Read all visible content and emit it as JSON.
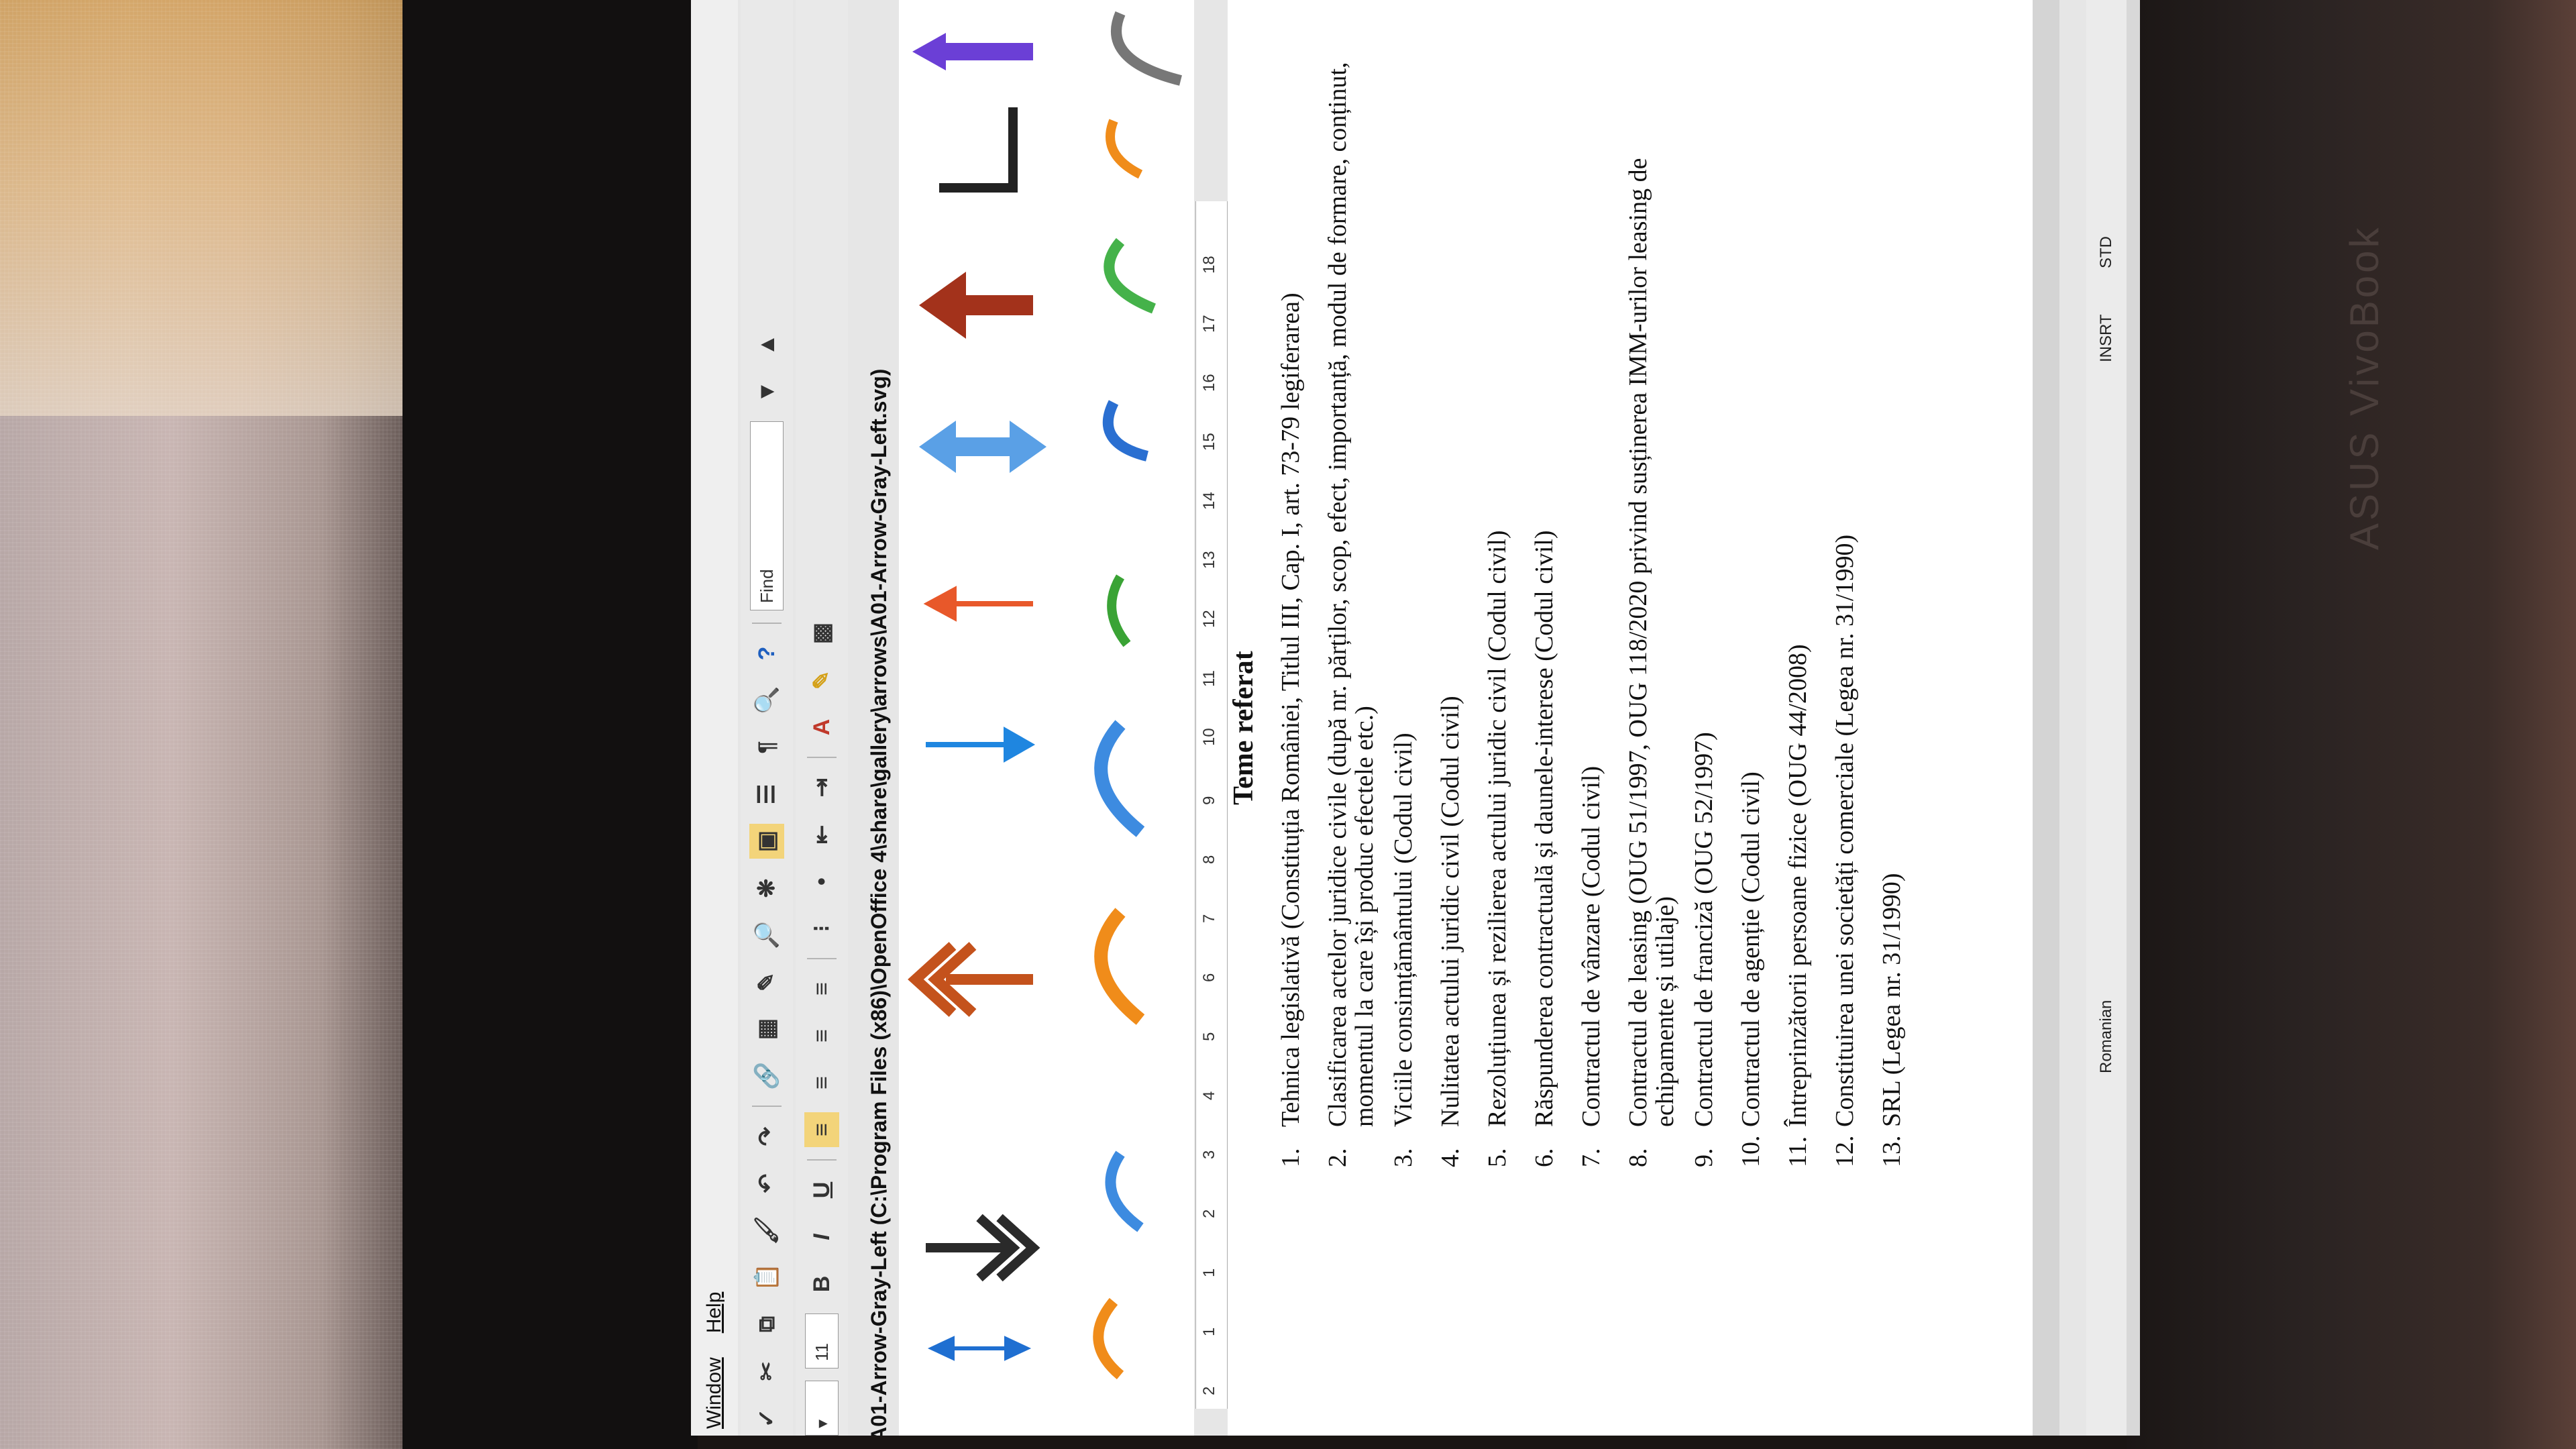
{
  "menu": {
    "items": [
      "Window",
      "Help"
    ]
  },
  "toolbar": {
    "font_size": "11",
    "find_placeholder": "Find",
    "bold": "B",
    "italic": "I",
    "underline": "U",
    "help_glyph": "?"
  },
  "document": {
    "path_title": "A01-Arrow-Gray-Left (C:\\Program Files (x86)\\OpenOffice 4\\share\\gallery\\arrows\\A01-Arrow-Gray-Left.svg)",
    "heading": "Teme referat",
    "topics": [
      "Tehnica legislativă (Constituția României, Titlul III, Cap. I, art. 73-79 legiferarea)",
      "Clasificarea actelor juridice civile (după nr. părților, scop, efect, importanță, modul de formare, conținut, momentul la care își produc efectele etc.)",
      "Viciile consimțământului (Codul civil)",
      "Nulitatea actului juridic civil (Codul civil)",
      "Rezoluțiunea și rezilierea actului juridic civil (Codul civil)",
      "Răspunderea contractuală și daunele-interese (Codul civil)",
      "Contractul de vânzare (Codul civil)",
      "Contractul de leasing (OUG 51/1997, OUG 118/2020 privind susținerea IMM-urilor leasing de echipamente și utilaje)",
      "Contractul de franciză (OUG 52/1997)",
      "Contractul de agenție (Codul civil)",
      "Întreprinzătorii persoane fizice (OUG 44/2008)",
      "Constituirea unei societăți comerciale (Legea nr. 31/1990)",
      "SRL (Legea nr. 31/1990)"
    ],
    "topic_numbers": [
      "1.",
      "2.",
      "3.",
      "4.",
      "5.",
      "6.",
      "7.",
      "8.",
      "9.",
      "10.",
      "11.",
      "12.",
      "13."
    ]
  },
  "ruler": {
    "ticks": [
      "2",
      "1",
      "1",
      "2",
      "3",
      "4",
      "5",
      "6",
      "7",
      "8",
      "9",
      "10",
      "11",
      "12",
      "13",
      "14",
      "15",
      "16",
      "17",
      "18"
    ]
  },
  "status": {
    "language": "Romanian",
    "insert_mode": "INSRT",
    "selection_mode": "STD"
  },
  "laptop": {
    "brand": "ASUS VivoBook"
  }
}
